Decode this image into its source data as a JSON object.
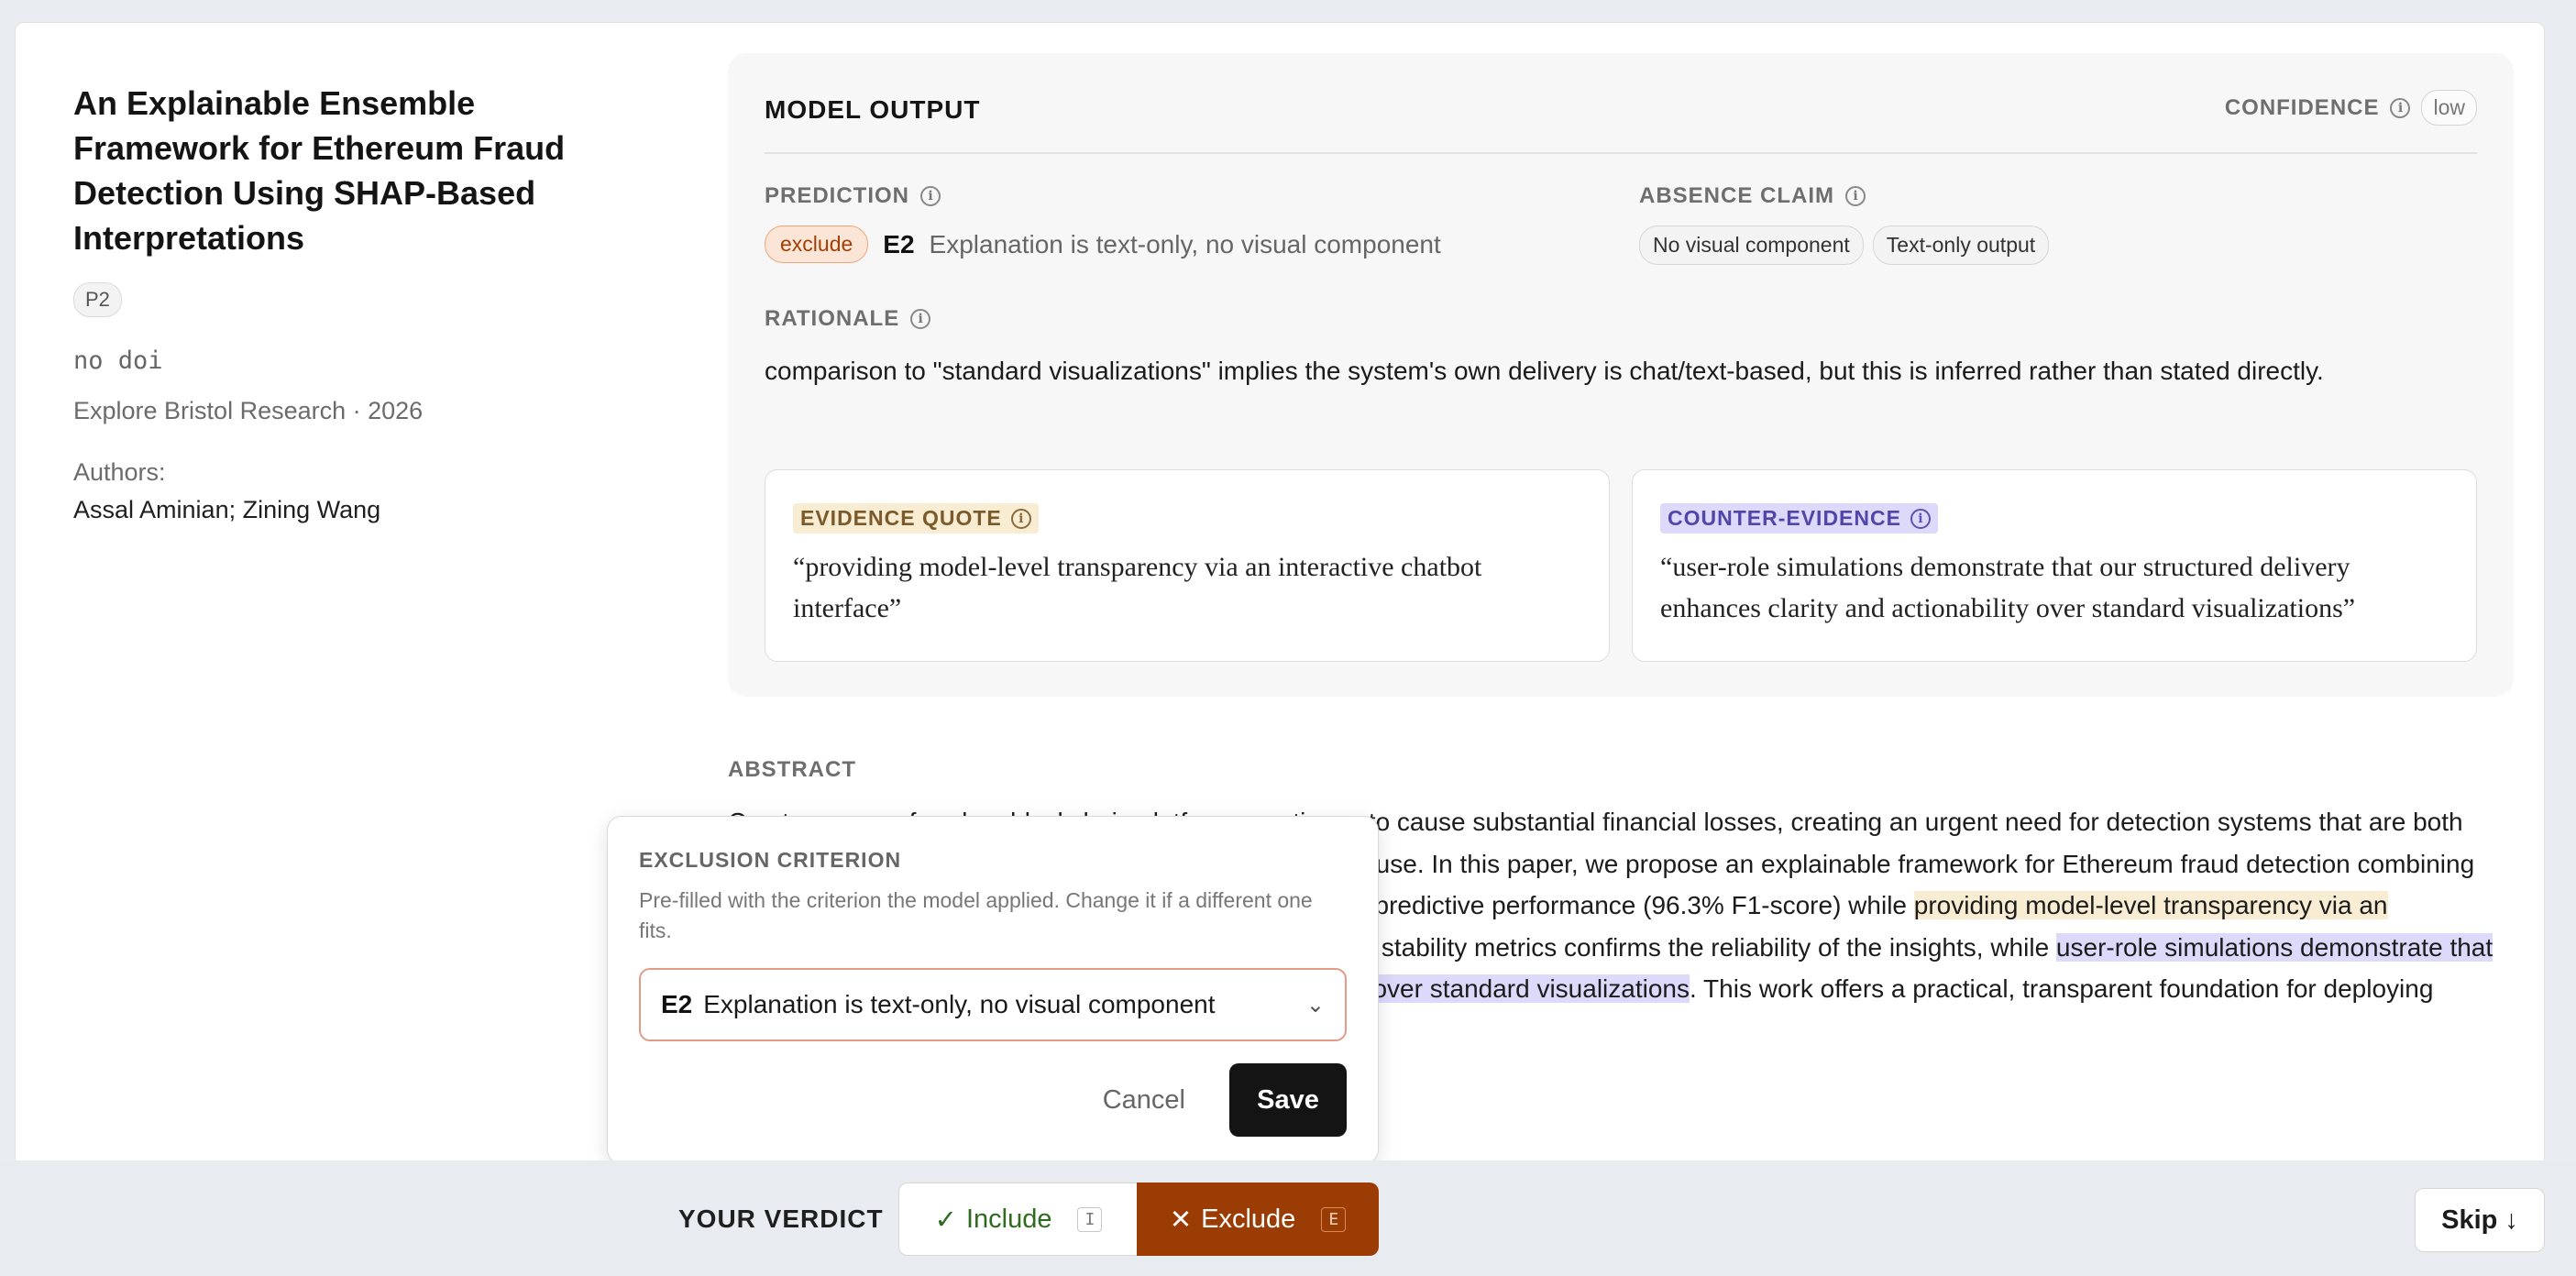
{
  "paper": {
    "title": "An Explainable Ensemble Framework for Ethereum Fraud Detection Using SHAP-Based Interpretations",
    "priority": "P2",
    "doi": "no doi",
    "venue": "Explore Bristol Research · 2026",
    "authors_label": "Authors:",
    "authors": "Assal Aminian; Zining Wang"
  },
  "model_output": {
    "title": "MODEL OUTPUT",
    "confidence_label": "CONFIDENCE",
    "confidence_value": "low",
    "prediction_label": "PREDICTION",
    "prediction_badge": "exclude",
    "prediction_code": "E2",
    "prediction_text": "Explanation is text-only, no visual component",
    "absence_label": "ABSENCE CLAIM",
    "absence_chips": [
      "No visual component",
      "Text-only output"
    ],
    "rationale_label": "RATIONALE",
    "rationale": "comparison to \"standard visualizations\" implies the system's own delivery is chat/text-based, but this is inferred rather than stated directly.",
    "evidence_label": "EVIDENCE QUOTE",
    "evidence_quote": "“providing model-level transparency via an interactive chatbot interface”",
    "counter_label": "COUNTER-EVIDENCE",
    "counter_quote": "“user-role simulations demonstrate that our structured delivery enhances clarity and actionability over standard visualizations”"
  },
  "abstract": {
    "label": "ABSTRACT",
    "p1": "Cryptocurrency fraud on blockchain platforms continues to cause substantial financial losses, creating an urgent need for detection systems that are both accurate and interpretable for operational and regulatory use. In this paper, we propose an explainable framework for Ethereum fraud detection combining an ensemble with TreeSHAP. This system achieves high predictive performance (96.3% F1-score) while ",
    "hl1": "providing model-level transparency via an interactive chatbot interface",
    "p2": ". Evaluation using fidelity and stability metrics confirms the reliability of the insights, while ",
    "hl2": "user-role simulations demonstrate that our structured delivery enhances clarity and actionability over standard visualizations",
    "p3": ". This work offers a practical, transparent foundation for deploying robust AI in high-risk financial environments."
  },
  "popover": {
    "title": "EXCLUSION CRITERION",
    "description": "Pre-filled with the criterion the model applied. Change it if a different one fits.",
    "select_code": "E2",
    "select_text": "Explanation is text-only, no visual component",
    "cancel": "Cancel",
    "save": "Save"
  },
  "verdict": {
    "label": "YOUR VERDICT",
    "include": "Include",
    "include_key": "I",
    "exclude": "Exclude",
    "exclude_key": "E",
    "skip": "Skip"
  },
  "colors": {
    "exclude_bg": "#9c3c05",
    "include_text": "#2f6b1f",
    "evidence_tag": "#f8ecd2",
    "counter_tag": "#dcd9fb"
  }
}
